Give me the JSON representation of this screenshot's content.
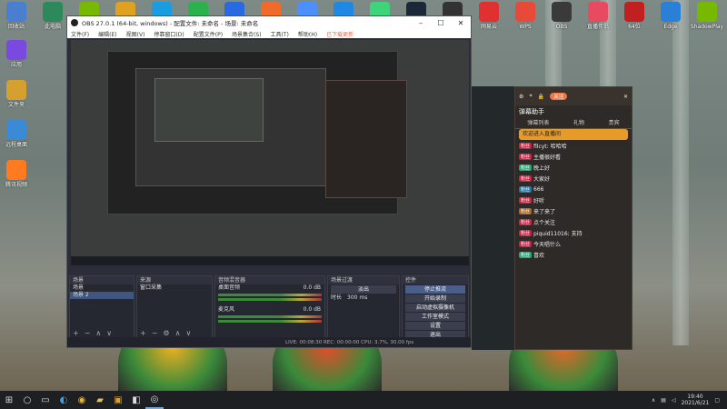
{
  "obs": {
    "title": "OBS 27.0.1 (64-bit, windows) - 配置文件: 未命名 - 场景: 未命名",
    "menu": [
      "文件(F)",
      "编辑(E)",
      "视图(V)",
      "停靠窗口(D)",
      "配置文件(P)",
      "场景集合(S)",
      "工具(T)",
      "帮助(H)",
      "已下载更新"
    ],
    "docks": {
      "scenes": {
        "header": "场景",
        "items": [
          "场景",
          "场景 2"
        ]
      },
      "sources": {
        "header": "来源",
        "items": [
          "窗口采集"
        ]
      },
      "mixer": {
        "header": "音频混音器",
        "channels": [
          "桌面音频",
          "麦克风"
        ],
        "levels": [
          "0.0 dB",
          "0.0 dB"
        ]
      },
      "transitions": {
        "header": "场景过渡",
        "type": "淡出",
        "duration_label": "时长",
        "duration": "300 ms"
      },
      "controls": {
        "header": "控件",
        "buttons": [
          "停止推流",
          "开始录制",
          "启动虚拟摄像机",
          "工作室模式",
          "设置",
          "退出"
        ]
      }
    },
    "statusbar": "LIVE: 00:08:30   REC: 00:00:00   CPU: 3.7%, 30.00 fps"
  },
  "chat": {
    "follow_pill": "关注",
    "title": "弹幕助手",
    "tabs": [
      "弹幕列表",
      "礼物",
      "贵宾"
    ],
    "banner": "欢迎进入直播间",
    "messages": [
      {
        "badge": "粉丝",
        "color": "#c24",
        "text": "fllcyt: 哈哈哈"
      },
      {
        "badge": "粉丝",
        "color": "#c24",
        "text": "主播很好看"
      },
      {
        "badge": "粉丝",
        "color": "#2a7",
        "text": "晚上好"
      },
      {
        "badge": "粉丝",
        "color": "#c24",
        "text": "大家好"
      },
      {
        "badge": "粉丝",
        "color": "#27a",
        "text": "666"
      },
      {
        "badge": "粉丝",
        "color": "#c24",
        "text": "好听"
      },
      {
        "badge": "粉丝",
        "color": "#a62",
        "text": "来了来了"
      },
      {
        "badge": "粉丝",
        "color": "#c24",
        "text": "点个关注"
      },
      {
        "badge": "粉丝",
        "color": "#c24",
        "text": "piquid11016: 支持"
      },
      {
        "badge": "粉丝",
        "color": "#c24",
        "text": "今天唱什么"
      },
      {
        "badge": "粉丝",
        "color": "#2a7",
        "text": "喜欢"
      }
    ]
  },
  "desktop_icons": [
    "回收站",
    "此电脑",
    "NVIDIA",
    "Chrome",
    "QQ",
    "微信",
    "酷狗",
    "百度网盘",
    "腾讯会议",
    "迅雷",
    "QQ音乐",
    "Steam",
    "Epic",
    "网易云",
    "WPS",
    "OBS",
    "直播伴侣",
    "64位",
    "Edge",
    "ShadowPlay",
    "应用",
    "文件夹",
    "远程桌面",
    "腾讯视频"
  ],
  "taskbar": {
    "time": "19:40",
    "date": "2021/6/21",
    "items": [
      "start-icon",
      "search-icon",
      "task-view-icon",
      "edge-icon",
      "chrome-icon",
      "folder-icon",
      "game-icon",
      "obs-icon",
      "app-icon",
      "app2-icon"
    ]
  }
}
